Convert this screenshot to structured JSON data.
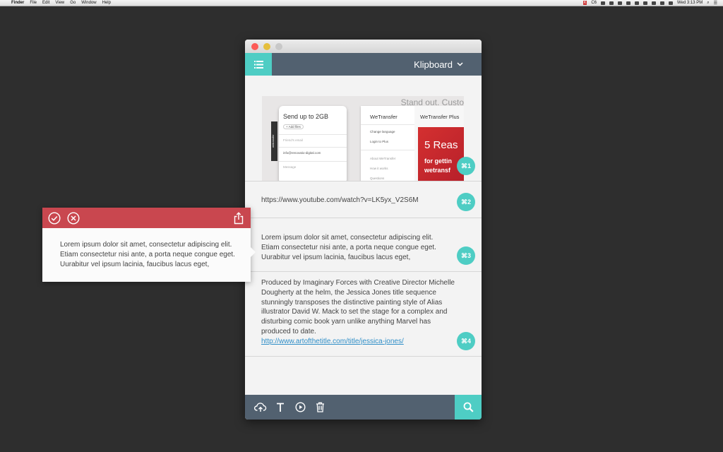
{
  "menubar": {
    "apple": "",
    "app": "Finder",
    "items": [
      "File",
      "Edit",
      "View",
      "Go",
      "Window",
      "Help"
    ],
    "tray_badge": "K",
    "tray_pct": "C6",
    "clock": "Wed 3:13 PM"
  },
  "app": {
    "title": "Klipboard",
    "clips": [
      {
        "type": "image",
        "shortcut": "⌘1",
        "thumb": {
          "standout": "Stand out. Custo",
          "sidebar_tag": "wetransfer",
          "card1_title": "Send up to 2GB",
          "card1_add": "+ Add files",
          "card1_fields": [
            "Friend's email",
            "info@renovatio-digital.com",
            "Message"
          ],
          "card2_title": "WeTransfer",
          "card2_items": [
            "Change language",
            "Login to Plus",
            "About WeTransfer",
            "How it works",
            "Questions"
          ],
          "card3_title": "WeTransfer Plus",
          "promo_line1": "5 Reas",
          "promo_line2": "for gettin",
          "promo_line3": "wetransf"
        }
      },
      {
        "type": "url",
        "text": "https://www.youtube.com/watch?v=LK5yx_V2S6M",
        "shortcut": "⌘2"
      },
      {
        "type": "text",
        "lines": [
          "Lorem ipsum dolor sit amet, consectetur adipiscing elit.",
          "Etiam consectetur nisi ante, a porta neque congue eget.",
          "Uurabitur vel ipsum lacinia, faucibus lacus eget,"
        ],
        "shortcut": "⌘3"
      },
      {
        "type": "text",
        "lines": [
          "Produced by Imaginary Forces with Creative Director Michelle",
          "Dougherty at the helm, the Jessica Jones title sequence",
          "stunningly transposes the distinctive painting style of Alias",
          "illustrator David W. Mack to set the stage for a complex and",
          "disturbing comic book yarn unlike anything Marvel has",
          "produced to date."
        ],
        "link": "http://www.artofthetitle.com/title/jessica-jones/",
        "shortcut": "⌘4"
      }
    ],
    "footer_icons": [
      "cloud-upload-icon",
      "text-icon",
      "play-icon",
      "trash-icon",
      "search-icon"
    ]
  },
  "popup": {
    "lines": [
      "Lorem ipsum dolor sit amet, consectetur adipiscing elit.",
      "Etiam consectetur nisi ante, a porta neque congue eget.",
      "Uurabitur vel ipsum lacinia, faucibus lacus eget,"
    ],
    "icons": [
      "check-circle-icon",
      "close-circle-icon",
      "share-icon"
    ]
  },
  "colors": {
    "desktop": "#2e2e2e",
    "header": "#526170",
    "accent": "#4ecdc4",
    "popup_header": "#c9474f",
    "link": "#2f8ec7"
  }
}
